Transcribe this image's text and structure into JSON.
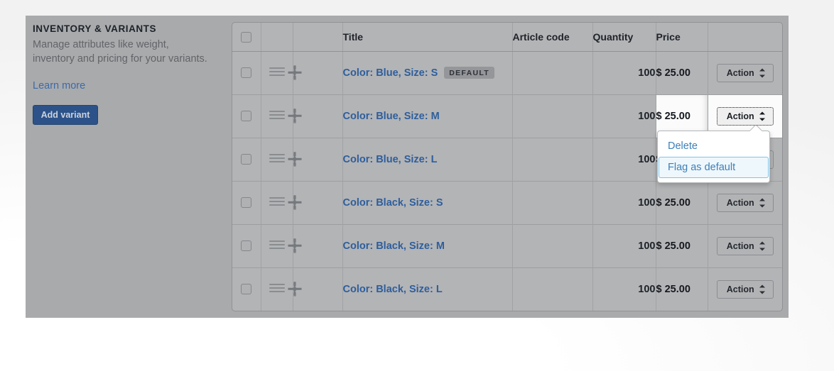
{
  "section": {
    "eyebrow": "INVENTORY & VARIANTS",
    "description": "Manage attributes like weight, inventory and pricing for your variants.",
    "learn_more_label": "Learn more",
    "add_variant_label": "Add variant"
  },
  "table": {
    "columns": {
      "select_all": "",
      "drag": "",
      "image": "",
      "title": "Title",
      "article_code": "Article code",
      "quantity": "Quantity",
      "price": "Price",
      "action": ""
    },
    "rows": [
      {
        "title": "Color: Blue, Size: S",
        "badge": "DEFAULT",
        "article_code": "",
        "quantity": "100",
        "price": "$ 25.00",
        "action_label": "Action"
      },
      {
        "title": "Color: Blue, Size: M",
        "badge": "",
        "article_code": "",
        "quantity": "100",
        "price": "$ 25.00",
        "action_label": "Action"
      },
      {
        "title": "Color: Blue, Size: L",
        "badge": "",
        "article_code": "",
        "quantity": "100",
        "price": "$ 25.00",
        "action_label": "Action"
      },
      {
        "title": "Color: Black, Size: S",
        "badge": "",
        "article_code": "",
        "quantity": "100",
        "price": "$ 25.00",
        "action_label": "Action"
      },
      {
        "title": "Color: Black, Size: M",
        "badge": "",
        "article_code": "",
        "quantity": "100",
        "price": "$ 25.00",
        "action_label": "Action"
      },
      {
        "title": "Color: Black, Size: L",
        "badge": "",
        "article_code": "",
        "quantity": "100",
        "price": "$ 25.00",
        "action_label": "Action"
      }
    ]
  },
  "dropdown": {
    "open_for_row_index": 1,
    "items": [
      {
        "label": "Delete",
        "hovered": false
      },
      {
        "label": "Flag as default",
        "hovered": true
      }
    ]
  },
  "icons": {
    "drag_handle": "drag-handle-icon",
    "image_placeholder": "add-image-plus-icon",
    "select_arrows": "sort-updown-icon",
    "checkbox": "checkbox-icon"
  },
  "colors": {
    "overlay": "#a9aaac",
    "link": "#2e5e9c",
    "menu_link": "#3d7fb8",
    "primary_button": "#2c5289",
    "badge": "#949699",
    "hover_border": "#7fc3e8"
  }
}
